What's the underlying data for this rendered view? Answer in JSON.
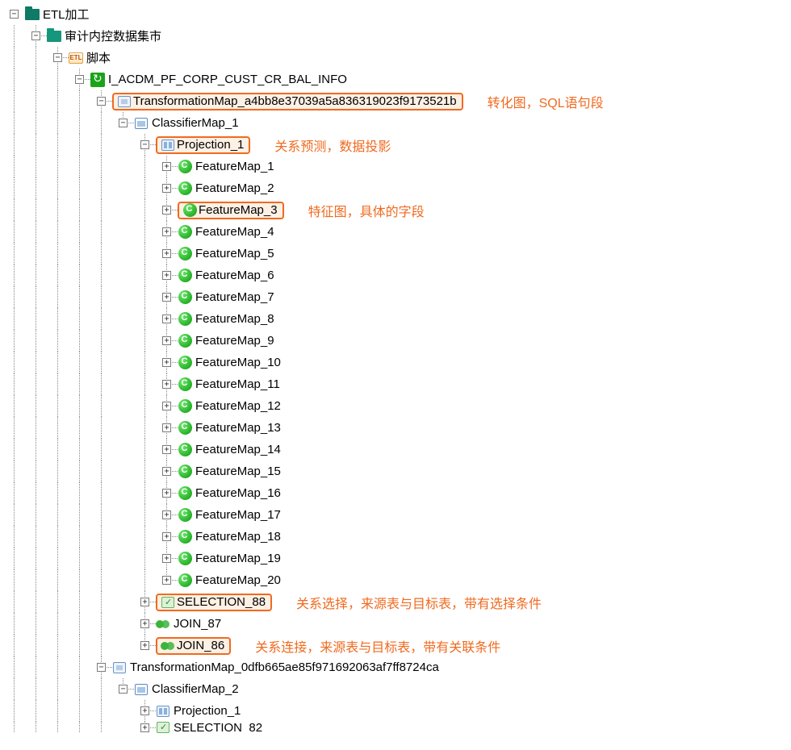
{
  "tree": {
    "root": {
      "label": "ETL加工"
    },
    "sub1": {
      "label": "审计内控数据集市"
    },
    "script": {
      "label": "脚本"
    },
    "task": {
      "label": "I_ACDM_PF_CORP_CUST_CR_BAL_INFO"
    },
    "tmap1": {
      "label": "TransformationMap_a4bb8e37039a5a836319023f9173521b"
    },
    "cmap1": {
      "label": "ClassifierMap_1"
    },
    "proj1": {
      "label": "Projection_1"
    },
    "features": [
      "FeatureMap_1",
      "FeatureMap_2",
      "FeatureMap_3",
      "FeatureMap_4",
      "FeatureMap_5",
      "FeatureMap_6",
      "FeatureMap_7",
      "FeatureMap_8",
      "FeatureMap_9",
      "FeatureMap_10",
      "FeatureMap_11",
      "FeatureMap_12",
      "FeatureMap_13",
      "FeatureMap_14",
      "FeatureMap_15",
      "FeatureMap_16",
      "FeatureMap_17",
      "FeatureMap_18",
      "FeatureMap_19",
      "FeatureMap_20"
    ],
    "sel88": {
      "label": "SELECTION_88"
    },
    "join87": {
      "label": "JOIN_87"
    },
    "join86": {
      "label": "JOIN_86"
    },
    "tmap2": {
      "label": "TransformationMap_0dfb665ae85f971692063af7ff8724ca"
    },
    "cmap2": {
      "label": "ClassifierMap_2"
    },
    "proj2": {
      "label": "Projection_1"
    },
    "sel82": {
      "label": "SELECTION_82"
    }
  },
  "annot": {
    "tmap": "转化图，SQL语句段",
    "proj": "关系预测，数据投影",
    "feat3": "特征图，具体的字段",
    "sel": "关系选择，来源表与目标表，带有选择条件",
    "join": "关系连接，来源表与目标表，带有关联条件"
  },
  "exp": {
    "minus": "−",
    "plus": "+"
  }
}
